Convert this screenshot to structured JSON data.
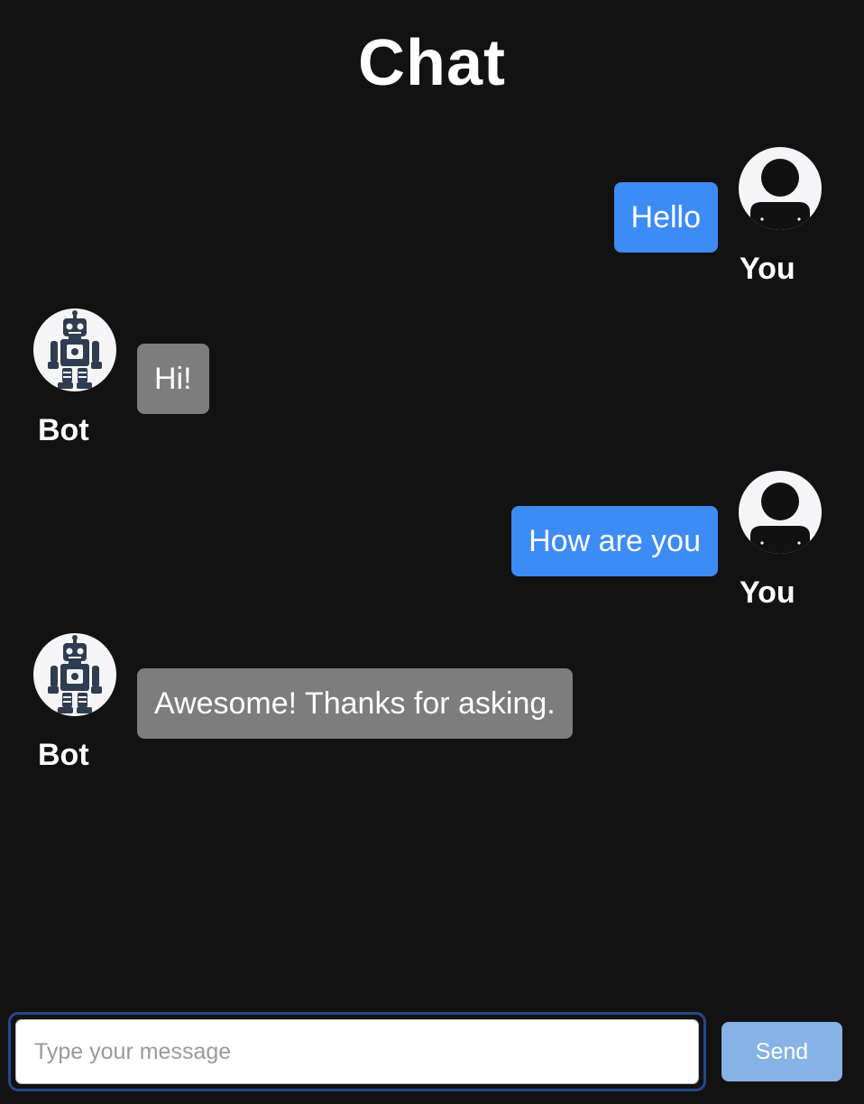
{
  "header": {
    "title": "Chat"
  },
  "messages": [
    {
      "sender": "user",
      "sender_label": "You",
      "text": "Hello",
      "avatar_icon": "user-avatar-icon"
    },
    {
      "sender": "bot",
      "sender_label": "Bot",
      "text": "Hi!",
      "avatar_icon": "robot-avatar-icon"
    },
    {
      "sender": "user",
      "sender_label": "You",
      "text": "How are you",
      "avatar_icon": "user-avatar-icon"
    },
    {
      "sender": "bot",
      "sender_label": "Bot",
      "text": "Awesome! Thanks for asking.",
      "avatar_icon": "robot-avatar-icon"
    }
  ],
  "composer": {
    "placeholder": "Type your message",
    "value": "",
    "send_label": "Send"
  },
  "colors": {
    "background": "#121212",
    "user_bubble": "#3d8bf5",
    "bot_bubble": "#7d7d7d",
    "send_button": "#87b2e6",
    "input_focus_ring": "#23488e"
  }
}
